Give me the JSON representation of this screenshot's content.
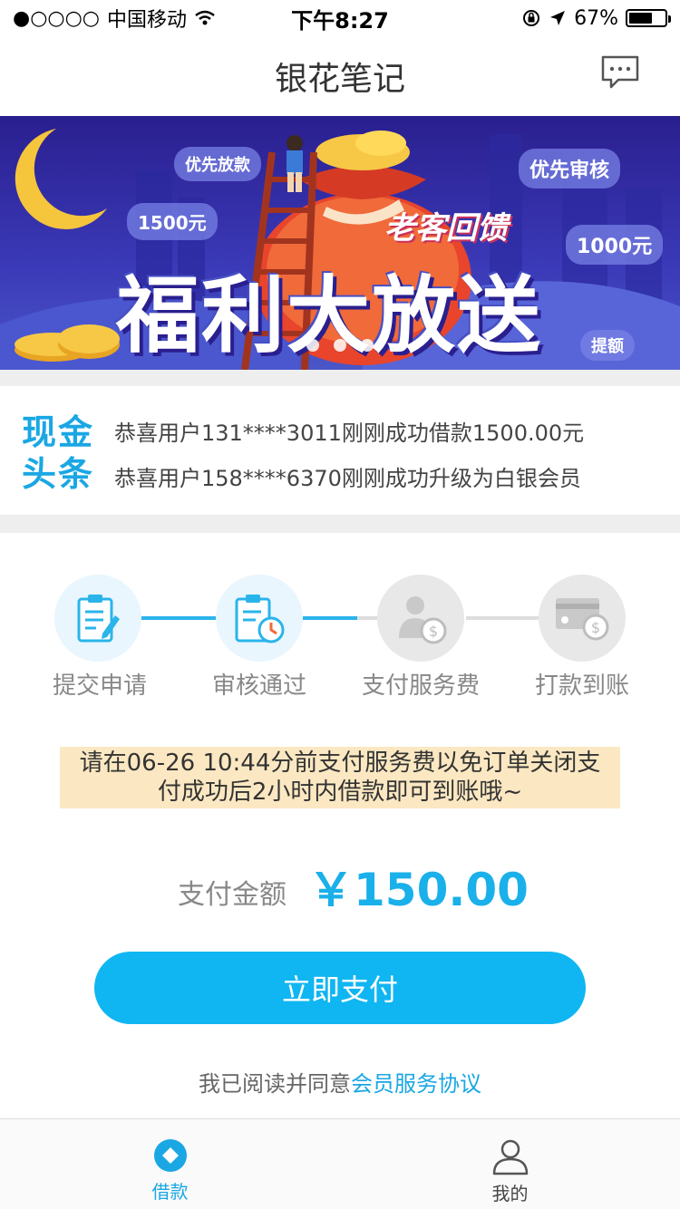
{
  "status_bar": {
    "signal": "●○○○○",
    "carrier": "中国移动",
    "time": "下午8:27",
    "battery_text": "67%",
    "battery_level": 0.67
  },
  "nav": {
    "title": "银花笔记",
    "message_icon": "chat-bubble-icon"
  },
  "banner": {
    "bubble_1": "优先放款",
    "bubble_2": "优先审核",
    "bubble_3": "1500元",
    "bubble_4": "1000元",
    "bubble_5": "提额",
    "subtitle": "老客回馈",
    "title": "福利大放送",
    "pages": 3
  },
  "news": {
    "badge": "现金头条",
    "items": [
      "恭喜用户131****3011刚刚成功借款1500.00元",
      "恭喜用户158****6370刚刚成功升级为白银会员"
    ]
  },
  "steps": [
    {
      "label": "提交申请",
      "icon": "clipboard-edit-icon",
      "done": true
    },
    {
      "label": "审核通过",
      "icon": "clipboard-clock-icon",
      "done": true
    },
    {
      "label": "支付服务费",
      "icon": "person-coin-icon",
      "done": false
    },
    {
      "label": "打款到账",
      "icon": "card-coin-icon",
      "done": false
    }
  ],
  "notice": {
    "line1": "请在06-26 10:44分前支付服务费以免订单关闭支",
    "line2": "付成功后2小时内借款即可到账哦~"
  },
  "payment": {
    "label": "支付金额",
    "amount": "￥150.00",
    "button": "立即支付"
  },
  "agreement": {
    "prefix": "我已阅读并同意",
    "link": "会员服务协议"
  },
  "tabbar": {
    "tabs": [
      {
        "label": "借款",
        "icon": "diamond-icon",
        "active": true
      },
      {
        "label": "我的",
        "icon": "person-icon",
        "active": false
      }
    ]
  },
  "colors": {
    "accent": "#1aa7e4",
    "button": "#10b6f2",
    "notice_bg": "#fbe8c2",
    "banner_bg": "#2a1f8f"
  }
}
